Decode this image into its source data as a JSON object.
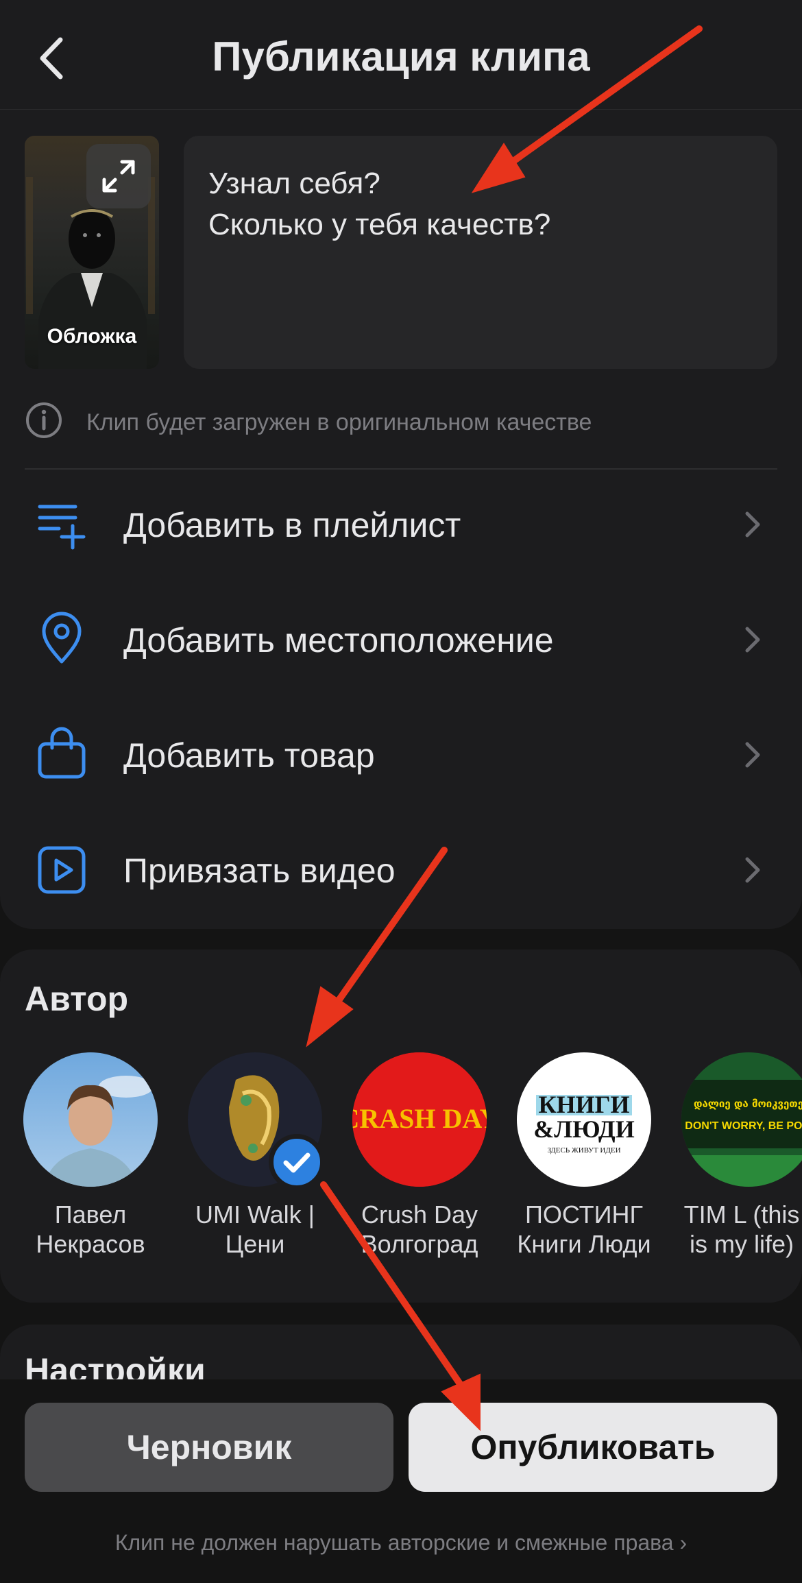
{
  "header": {
    "title": "Публикация клипа"
  },
  "cover": {
    "label": "Обложка"
  },
  "description": {
    "line1": "Узнал себя?",
    "line2": "Сколько у тебя качеств?"
  },
  "info": {
    "text": "Клип будет загружен в оригинальном качестве"
  },
  "menu": [
    {
      "label": "Добавить в плейлист",
      "icon": "playlist-add-icon"
    },
    {
      "label": "Добавить местоположение",
      "icon": "location-pin-icon"
    },
    {
      "label": "Добавить товар",
      "icon": "shopping-bag-icon"
    },
    {
      "label": "Привязать видео",
      "icon": "video-play-icon"
    }
  ],
  "author_section": {
    "title": "Автор",
    "authors": [
      {
        "name_line1": "Павел",
        "name_line2": "Некрасов",
        "selected": false
      },
      {
        "name_line1": "UMI Walk |",
        "name_line2": "Цени",
        "selected": true
      },
      {
        "name_line1": "Crush Day",
        "name_line2": "Волгоград",
        "selected": false,
        "avatar_text": "CRASH DAY"
      },
      {
        "name_line1": "ПОСТИНГ",
        "name_line2": "Книги Люди",
        "selected": false,
        "avatar_text1": "КНИГИ",
        "avatar_text2": "&ЛЮДИ",
        "avatar_text3": "ЗДЕСЬ ЖИВУТ ИДЕИ"
      },
      {
        "name_line1": "TIM L (this",
        "name_line2": "is my life)",
        "selected": false,
        "avatar_text1": "დალიე და მოიკვეთე",
        "avatar_text2": "DON'T WORRY, BE POFI"
      }
    ]
  },
  "settings": {
    "title": "Настройки"
  },
  "buttons": {
    "draft": "Черновик",
    "publish": "Опубликовать"
  },
  "footer": {
    "note": "Клип не должен нарушать авторские и смежные права"
  },
  "colors": {
    "accent_blue": "#3d8ef0",
    "annotation_red": "#e8341c",
    "background": "#141414",
    "card": "#1c1c1e"
  }
}
